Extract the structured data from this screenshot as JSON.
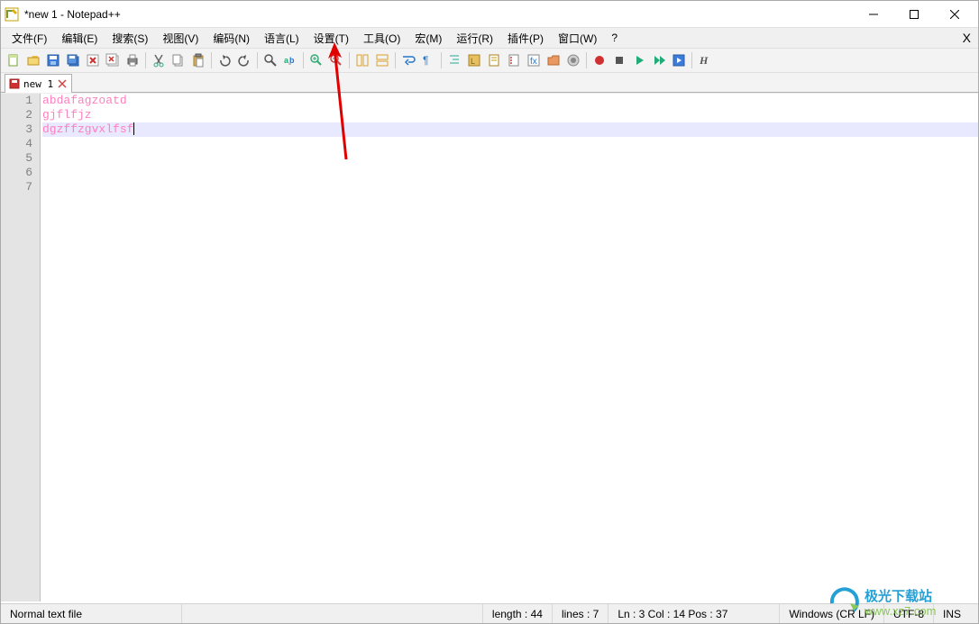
{
  "window": {
    "title": "*new 1 - Notepad++"
  },
  "menu": {
    "items": [
      "文件(F)",
      "编辑(E)",
      "搜索(S)",
      "视图(V)",
      "编码(N)",
      "语言(L)",
      "设置(T)",
      "工具(O)",
      "宏(M)",
      "运行(R)",
      "插件(P)",
      "窗口(W)",
      "?"
    ]
  },
  "tabs": [
    {
      "label": "new 1",
      "modified": true
    }
  ],
  "editor": {
    "lines": [
      "abdafagzoatd",
      "gjflfjz",
      "dgzffzgvxlfsf",
      "",
      "",
      "",
      ""
    ],
    "line_numbers": [
      "1",
      "2",
      "3",
      "4",
      "5",
      "6",
      "7"
    ],
    "current_line_index": 2
  },
  "status": {
    "file_type": "Normal text file",
    "length_label": "length : 44",
    "lines_label": "lines : 7",
    "cursor_label": "Ln : 3    Col : 14    Pos : 37",
    "eol": "Windows (CR LF)",
    "encoding": "UTF-8",
    "mode": "INS"
  },
  "watermark": {
    "title": "极光下载站",
    "url": "www.xz7.com"
  },
  "colors": {
    "text_pink": "#ff80c0",
    "gutter_bg": "#e4e4e4",
    "current_line": "#e8e8ff"
  }
}
